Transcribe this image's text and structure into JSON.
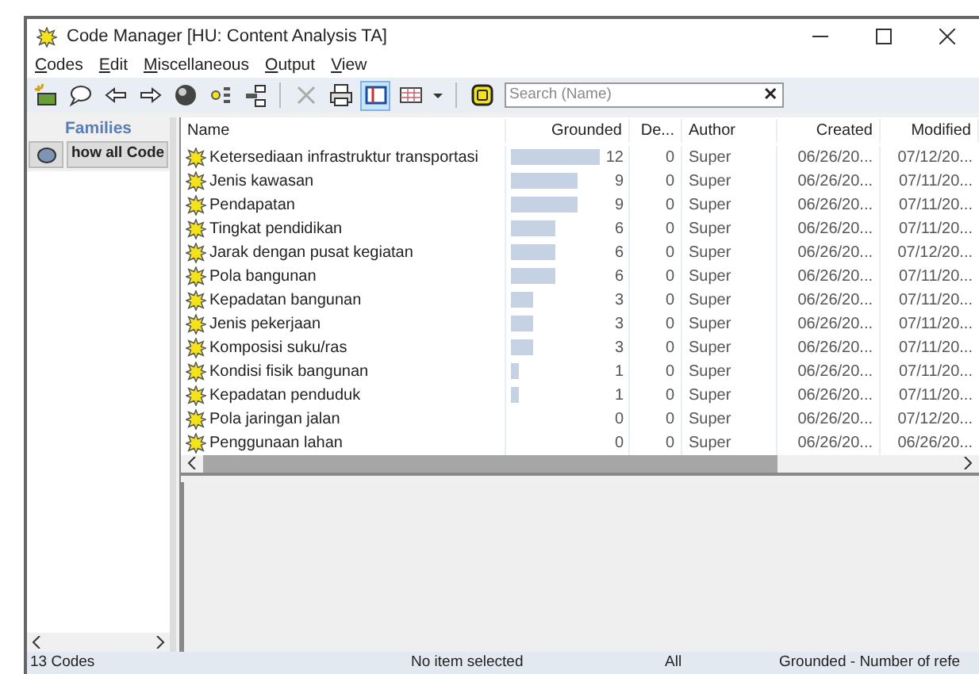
{
  "window": {
    "title": "Code Manager [HU: Content Analysis TA]"
  },
  "menu": [
    "Codes",
    "Edit",
    "Miscellaneous",
    "Output",
    "View"
  ],
  "toolbar": [
    [
      {
        "kind": "new",
        "selected": false
      },
      {
        "kind": "comment",
        "selected": false
      },
      {
        "kind": "back",
        "selected": false
      },
      {
        "kind": "forward",
        "selected": false
      },
      {
        "kind": "sphere",
        "selected": false
      },
      {
        "kind": "network",
        "selected": false
      },
      {
        "kind": "tree",
        "selected": false
      }
    ],
    [
      {
        "kind": "delete",
        "selected": false
      },
      {
        "kind": "print",
        "selected": false
      },
      {
        "kind": "pane",
        "selected": true
      },
      {
        "kind": "grid",
        "selected": false
      },
      {
        "kind": "dropdown",
        "selected": false
      }
    ],
    [
      {
        "kind": "filter",
        "selected": false
      }
    ]
  ],
  "search": {
    "placeholder": "Search (Name)",
    "clear": "✕"
  },
  "families": {
    "title": "Families",
    "filter_label": "how all Code"
  },
  "table": {
    "columns": [
      "Name",
      "Grounded",
      "De...",
      "Author",
      "Created",
      "Modified"
    ],
    "rows": [
      {
        "name": "Ketersediaan infrastruktur transportasi",
        "grounded": "12",
        "density": "0",
        "author": "Super",
        "created": "06/26/20...",
        "modified": "07/12/20..."
      },
      {
        "name": "Jenis kawasan",
        "grounded": "9",
        "density": "0",
        "author": "Super",
        "created": "06/26/20...",
        "modified": "07/11/20..."
      },
      {
        "name": "Pendapatan",
        "grounded": "9",
        "density": "0",
        "author": "Super",
        "created": "06/26/20...",
        "modified": "07/11/20..."
      },
      {
        "name": "Tingkat pendidikan",
        "grounded": "6",
        "density": "0",
        "author": "Super",
        "created": "06/26/20...",
        "modified": "07/11/20..."
      },
      {
        "name": "Jarak dengan pusat kegiatan",
        "grounded": "6",
        "density": "0",
        "author": "Super",
        "created": "06/26/20...",
        "modified": "07/12/20..."
      },
      {
        "name": "Pola bangunan",
        "grounded": "6",
        "density": "0",
        "author": "Super",
        "created": "06/26/20...",
        "modified": "07/11/20..."
      },
      {
        "name": "Kepadatan bangunan",
        "grounded": "3",
        "density": "0",
        "author": "Super",
        "created": "06/26/20...",
        "modified": "07/11/20..."
      },
      {
        "name": "Jenis pekerjaan",
        "grounded": "3",
        "density": "0",
        "author": "Super",
        "created": "06/26/20...",
        "modified": "07/11/20..."
      },
      {
        "name": "Komposisi suku/ras",
        "grounded": "3",
        "density": "0",
        "author": "Super",
        "created": "06/26/20...",
        "modified": "07/11/20..."
      },
      {
        "name": "Kondisi fisik bangunan",
        "grounded": "1",
        "density": "0",
        "author": "Super",
        "created": "06/26/20...",
        "modified": "07/11/20..."
      },
      {
        "name": "Kepadatan penduduk",
        "grounded": "1",
        "density": "0",
        "author": "Super",
        "created": "06/26/20...",
        "modified": "07/11/20..."
      },
      {
        "name": "Pola jaringan jalan",
        "grounded": "0",
        "density": "0",
        "author": "Super",
        "created": "06/26/20...",
        "modified": "07/12/20..."
      },
      {
        "name": "Penggunaan lahan",
        "grounded": "0",
        "density": "0",
        "author": "Super",
        "created": "06/26/20...",
        "modified": "06/26/20..."
      }
    ]
  },
  "status_bar": [
    "13 Codes",
    "No item selected",
    "All",
    "Grounded - Number of refe"
  ]
}
